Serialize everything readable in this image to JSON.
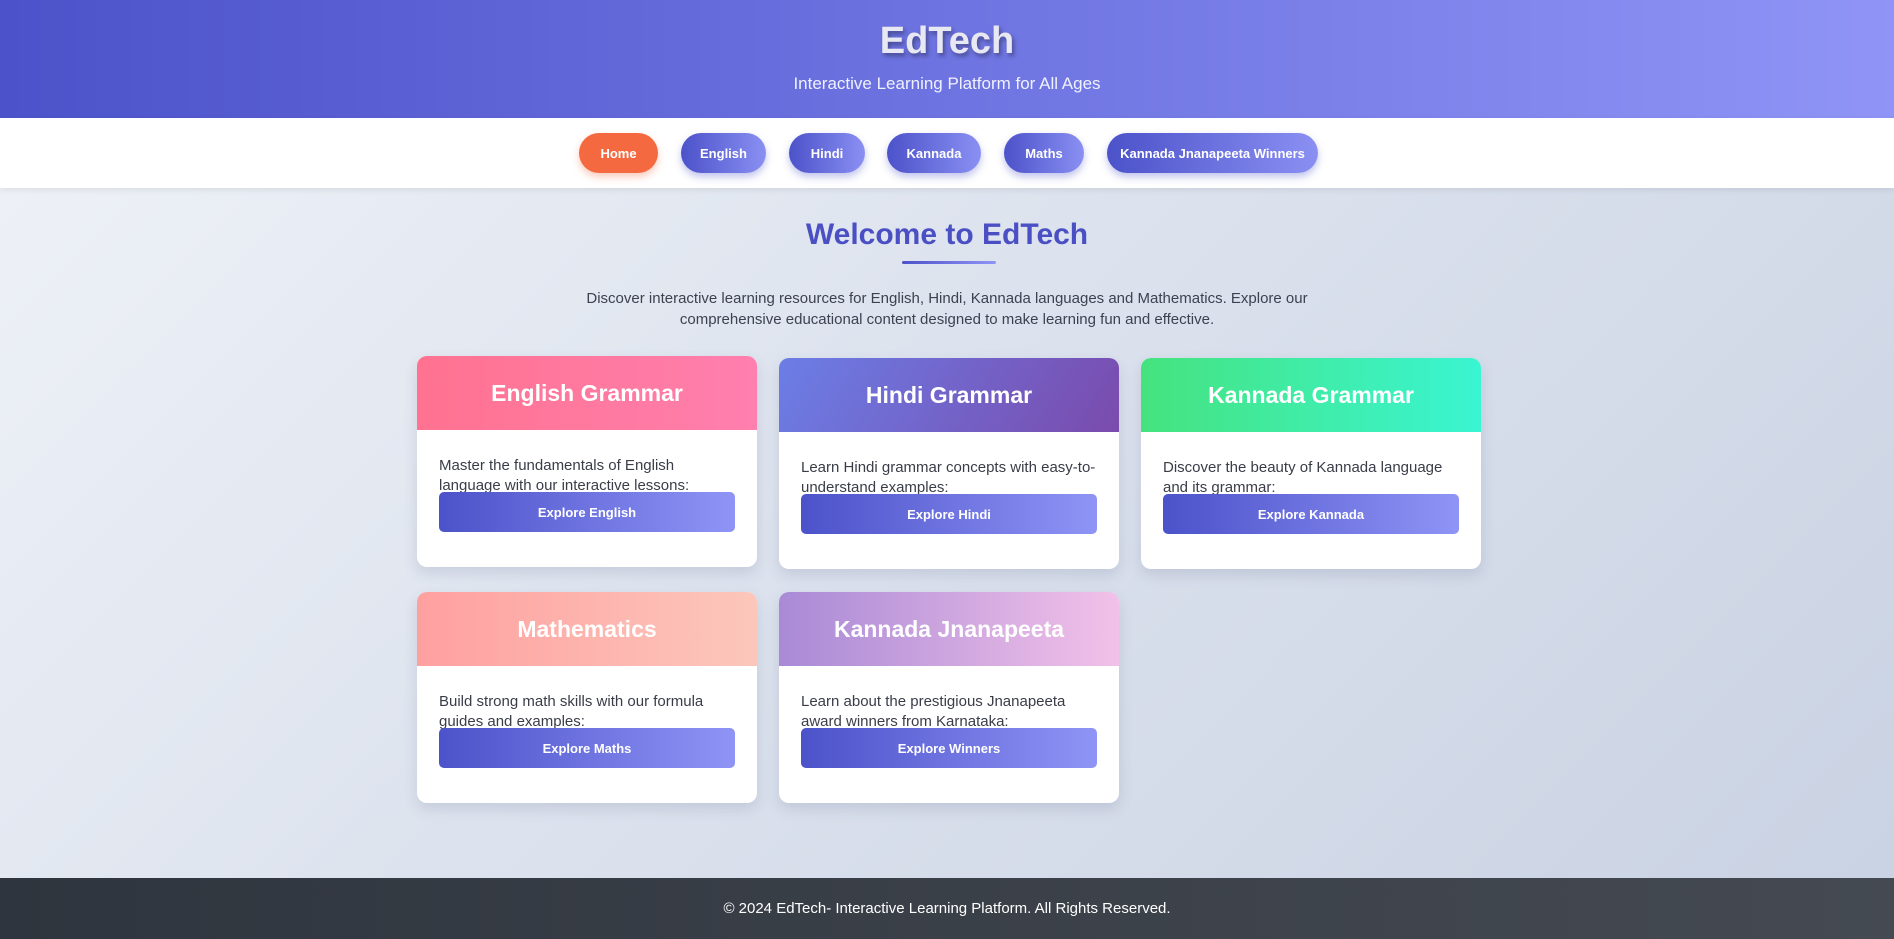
{
  "header": {
    "title": "EdTech",
    "subtitle": "Interactive Learning Platform for All Ages"
  },
  "nav": {
    "items": [
      {
        "label": "Home",
        "active": true
      },
      {
        "label": "English",
        "active": false
      },
      {
        "label": "Hindi",
        "active": false
      },
      {
        "label": "Kannada",
        "active": false
      },
      {
        "label": "Maths",
        "active": false
      },
      {
        "label": "Kannada Jnanapeeta Winners",
        "active": false
      }
    ]
  },
  "main": {
    "heading": "Welcome to EdTech",
    "intro": "Discover interactive learning resources for English, Hindi, Kannada languages and Mathematics. Explore our comprehensive educational content designed to make learning fun and effective."
  },
  "cards": [
    {
      "title": "English Grammar",
      "description": "Master the fundamentals of English language with our interactive lessons:",
      "button": "Explore English"
    },
    {
      "title": "Hindi Grammar",
      "description": "Learn Hindi grammar concepts with easy-to-understand examples:",
      "button": "Explore Hindi"
    },
    {
      "title": "Kannada Grammar",
      "description": "Discover the beauty of Kannada language and its grammar:",
      "button": "Explore Kannada"
    },
    {
      "title": "Mathematics",
      "description": "Build strong math skills with our formula guides and examples:",
      "button": "Explore Maths"
    },
    {
      "title": "Kannada Jnanapeeta",
      "description": "Learn about the prestigious Jnanapeeta award winners from Karnataka:",
      "button": "Explore Winners"
    }
  ],
  "footer": {
    "text": "© 2024 EdTech- Interactive Learning Platform. All Rights Reserved."
  },
  "colors": {
    "primary": "#4c52c9",
    "active_nav": "#f4693f",
    "footer_bg": "#2f353e"
  }
}
